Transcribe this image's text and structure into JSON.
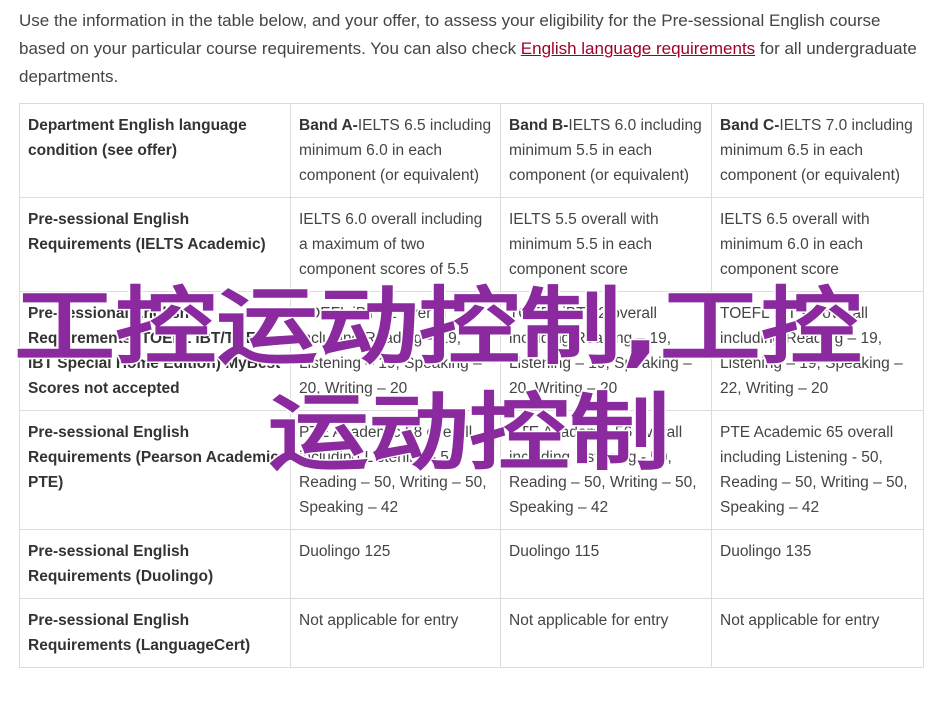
{
  "intro": {
    "text_before": "Use the information in the table below, and your offer, to assess your eligibility for the Pre-sessional English course based on your particular course requirements. You can also check ",
    "link_text": "English language requirements",
    "text_after": " for all undergraduate departments."
  },
  "table": {
    "header": {
      "label": "Department English language condition (see offer)",
      "bands": [
        {
          "name": "Band A-",
          "detail": "IELTS 6.5 including minimum 6.0 in each component (or equivalent)"
        },
        {
          "name": "Band B-",
          "detail": "IELTS 6.0 including minimum 5.5 in each component (or equivalent)"
        },
        {
          "name": "Band C-",
          "detail": "IELTS 7.0 including minimum 6.5 in each component (or equivalent)"
        }
      ]
    },
    "rows": [
      {
        "label": "Pre-sessional English Requirements (IELTS Academic)",
        "cells": [
          "IELTS 6.0 overall including a maximum of two component scores of 5.5",
          "IELTS 5.5 overall with minimum 5.5 in each component score",
          "IELTS 6.5 overall with minimum 6.0 in each component score"
        ]
      },
      {
        "label": "Pre-sessional English Requirements (TOEFL iBT/TOEFL iBT Special Home Edition) MyBest Scores not accepted",
        "cells": [
          "TOEFL iBT 72 overall including Reading – 19, Listening – 19, Speaking – 20, Writing – 20",
          "TOEFL iBT 72 overall including Reading – 19, Listening – 19, Speaking – 20, Writing – 20",
          "TOEFL iBT 92 overall including Reading – 19, Listening – 19, Speaking – 22, Writing – 20"
        ]
      },
      {
        "label": "Pre-sessional English Requirements (Pearson Academic PTE)",
        "cells": [
          "PTE Academic 58 overall including Listening - 50, Reading – 50, Writing – 50, Speaking – 42",
          "PTE Academic 56 overall including Listening - 50, Reading – 50, Writing – 50, Speaking – 42",
          "PTE Academic 65 overall including Listening - 50, Reading – 50, Writing – 50, Speaking – 42"
        ]
      },
      {
        "label": "Pre-sessional English Requirements (Duolingo)",
        "cells": [
          "Duolingo 125",
          "Duolingo 115",
          "Duolingo 135"
        ]
      },
      {
        "label": "Pre-sessional English Requirements (LanguageCert)",
        "cells": [
          "Not applicable for entry",
          "Not applicable for entry",
          "Not applicable for entry"
        ]
      }
    ]
  },
  "watermark": {
    "line1": "工控运动控制,工控",
    "line2": "运动控制",
    "color": "#8a2a9e"
  },
  "colors": {
    "link": "#a00028",
    "border": "#dcdcdc",
    "text": "#444444"
  }
}
